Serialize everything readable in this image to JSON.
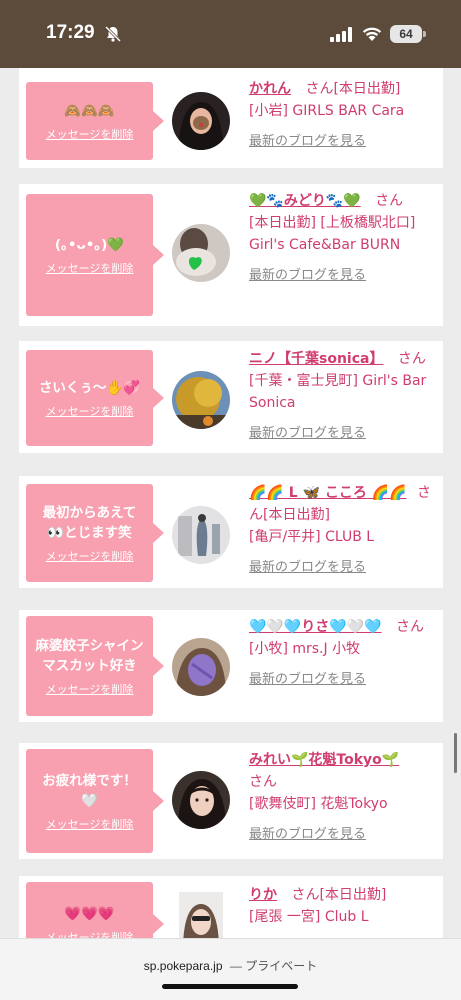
{
  "status": {
    "time": "17:29",
    "battery": "64",
    "icons": [
      "bell-slash-icon",
      "cellular-signal-icon",
      "wifi-icon",
      "battery-icon"
    ]
  },
  "delete_label": "メッセージを削除",
  "blog_label": "最新のブログを見る",
  "san_label": "さん",
  "messages": [
    {
      "message": "🙈🙈🙈",
      "name": "かれん",
      "status": "[本日出勤]",
      "shop": "[小岩] GIRLS BAR Cara"
    },
    {
      "message": "(｡•ᴗ•｡)💚",
      "name": "💚🐾みどり🐾💚",
      "status": "",
      "shop": "[本日出勤] [上板橋駅北口] Girl's Cafe&Bar BURN"
    },
    {
      "message": "さいくぅ〜🖐💞",
      "name": "ニノ【千葉sonica】",
      "status": "",
      "shop": "[千葉・富士見町] Girl's Bar Sonica"
    },
    {
      "message": "最初からあえて👀とじます笑",
      "name": "🌈🌈 L 🦋 こころ 🌈🌈",
      "status": "[本日出勤]",
      "shop": "[亀戸/平井] CLUB L"
    },
    {
      "message": "麻婆餃子シャインマスカット好き",
      "name": "🩵🤍🩵りさ🩵🤍🩵",
      "status": "",
      "shop": "[小牧] mrs.J 小牧"
    },
    {
      "message": "お疲れ様です！🤍",
      "name": "みれい🌱花魁Tokyo🌱",
      "status": "",
      "shop": "[歌舞伎町] 花魁Tokyo"
    },
    {
      "message": "💗💗💗",
      "name": "りか",
      "status": "[本日出勤]",
      "shop": "[尾張 一宮] Club L"
    }
  ],
  "browser": {
    "url": "sp.pokepara.jp",
    "mode": "— プライベート"
  }
}
